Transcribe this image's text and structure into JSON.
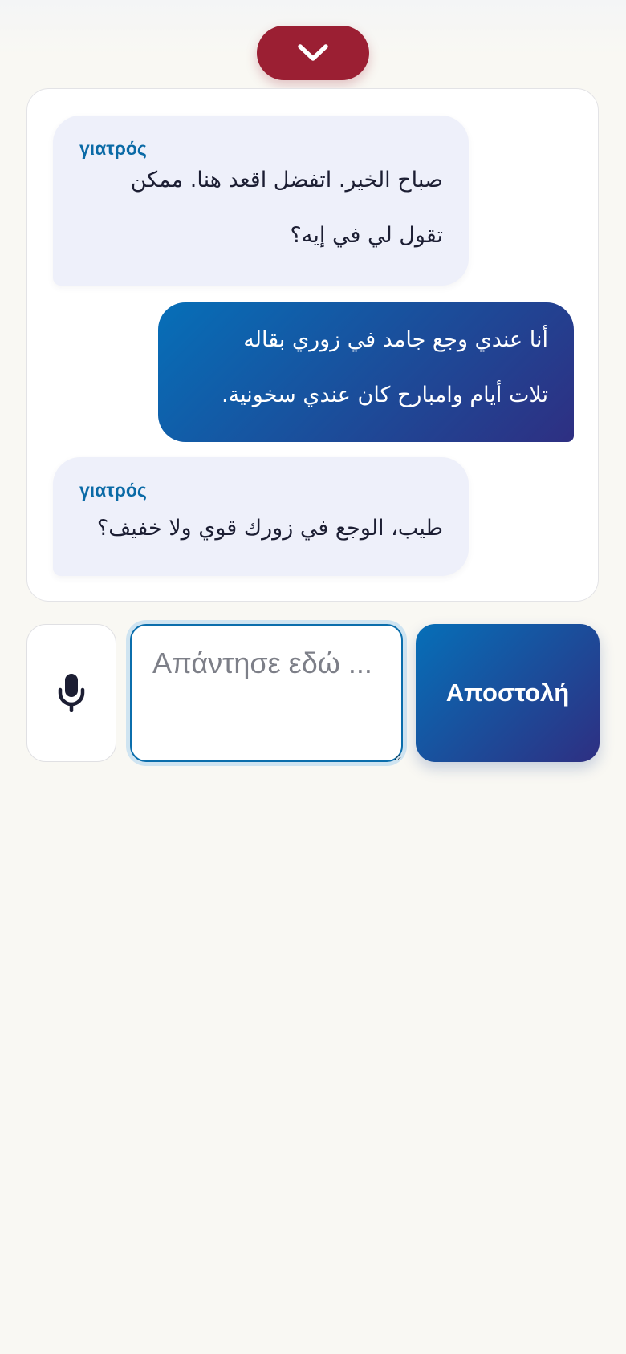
{
  "colors": {
    "collapse_button": "#9b1f33",
    "doctor_bubble": "#eef0fa",
    "patient_bubble_start": "#066fb8",
    "patient_bubble_end": "#2e2f82",
    "speaker_label": "#0a6aa6",
    "page_background": "#f9f8f3"
  },
  "header": {
    "collapse_icon": "chevron-down-icon"
  },
  "conversation": {
    "messages": [
      {
        "role": "doctor",
        "speaker": "γιατρός",
        "lines": [
          "صباح الخير. اتفضل اقعد هنا. ممكن",
          "تقول لي في إيه؟"
        ]
      },
      {
        "role": "patient",
        "lines": [
          "أنا عندي وجع جامد في زوري بقاله",
          "تلات أيام وامبارح كان عندي سخونية."
        ]
      },
      {
        "role": "doctor",
        "speaker": "γιατρός",
        "lines": [
          "طيب، الوجع في زورك قوي ولا خفيف؟"
        ]
      }
    ]
  },
  "composer": {
    "mic_icon": "microphone-icon",
    "input_placeholder": "Απάντησε εδώ ...",
    "input_value": "",
    "send_label": "Αποστολή"
  }
}
